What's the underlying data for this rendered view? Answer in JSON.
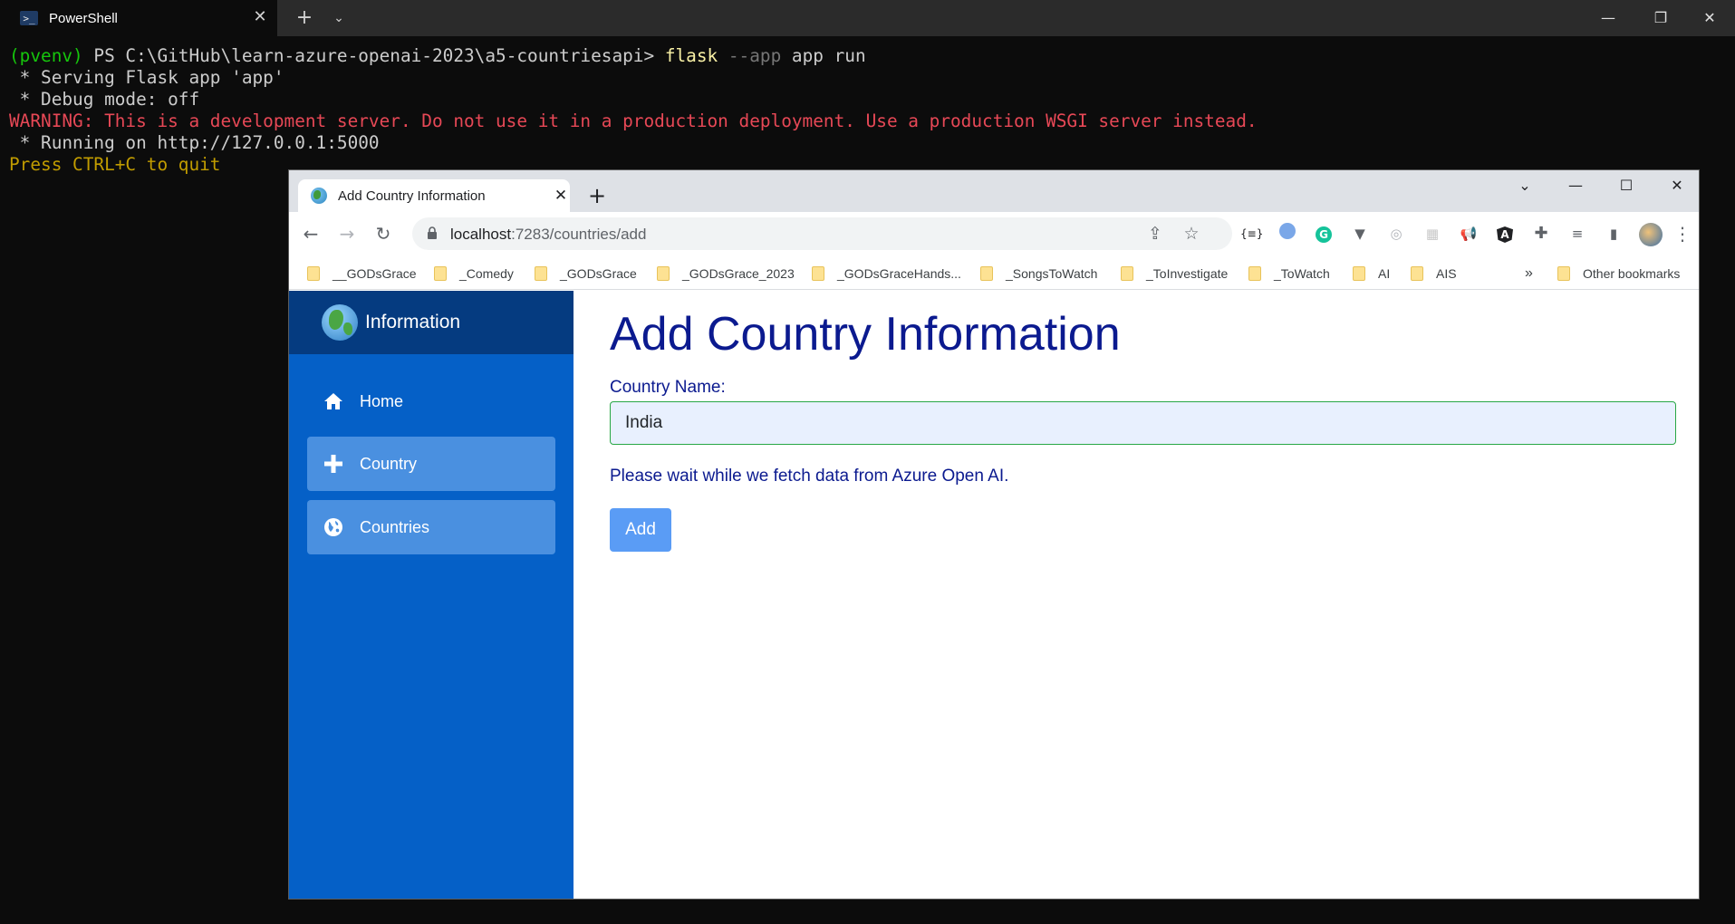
{
  "terminal": {
    "tab_title": "PowerShell",
    "lines": {
      "venv": "(pvenv)",
      "prompt": " PS C:\\GitHub\\learn-azure-openai-2023\\a5-countriesapi> ",
      "cmd": "flask",
      "flag": " --app",
      "args": " app run",
      "serving": " * Serving Flask app 'app'",
      "debug": " * Debug mode: off",
      "warning": "WARNING: This is a development server. Do not use it in a production deployment. Use a production WSGI server instead.",
      "running": " * Running on http://127.0.0.1:5000",
      "quit": "Press CTRL+C to quit"
    }
  },
  "browser": {
    "tab_title": "Add Country Information",
    "url_host": "localhost",
    "url_rest": ":7283/countries/add",
    "bookmarks": [
      "__GODsGrace",
      "_Comedy",
      "_GODsGrace",
      "_GODsGrace_2023",
      "_GODsGraceHands...",
      "_SongsToWatch",
      "_ToInvestigate",
      "_ToWatch",
      "AI",
      "AIS"
    ],
    "bookmarks_overflow": "»",
    "other_bookmarks": "Other bookmarks"
  },
  "sidebar": {
    "brand": "Information",
    "items": [
      {
        "label": "Home",
        "icon": "home-icon"
      },
      {
        "label": "Country",
        "icon": "plus-icon"
      },
      {
        "label": "Countries",
        "icon": "globe-icon"
      }
    ]
  },
  "main": {
    "title": "Add Country Information",
    "field_label": "Country Name:",
    "field_value": "India",
    "wait_message": "Please wait while we fetch data from Azure Open AI.",
    "add_button": "Add"
  },
  "colors": {
    "sidebar_bg": "#0560c7",
    "sidebar_head_bg": "#053b80",
    "active_item_bg": "#4a90e0",
    "heading_color": "#0b1a8f",
    "button_bg": "#5a9cf5"
  }
}
